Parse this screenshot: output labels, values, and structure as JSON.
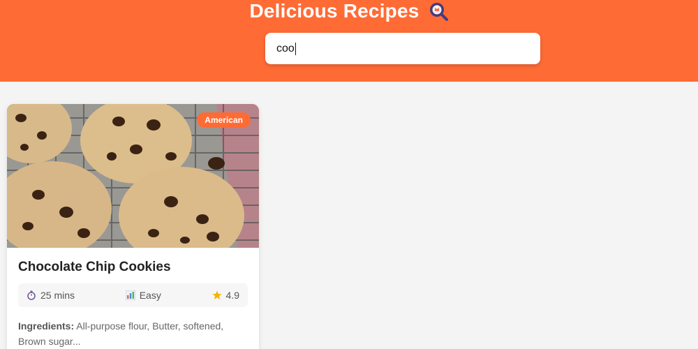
{
  "header": {
    "title": "Delicious Recipes",
    "logo_icon": "chef-magnifier-icon",
    "accent_color": "#ff6b35"
  },
  "search": {
    "value": "coo",
    "placeholder": ""
  },
  "recipes": [
    {
      "title": "Chocolate Chip Cookies",
      "cuisine": "American",
      "time": "25 mins",
      "difficulty": "Easy",
      "rating": "4.9",
      "ingredients_label": "Ingredients:",
      "ingredients": "All-purpose flour, Butter, softened, Brown sugar...",
      "image_icon": "cookie-photo",
      "time_icon": "stopwatch-icon",
      "difficulty_icon": "bar-chart-icon",
      "rating_icon": "star-icon"
    }
  ]
}
